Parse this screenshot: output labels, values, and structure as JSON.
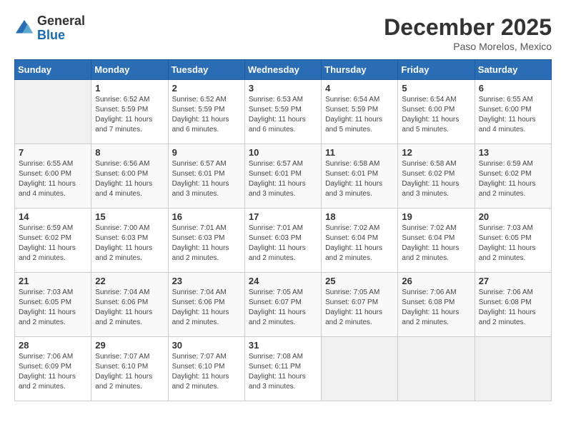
{
  "logo": {
    "general": "General",
    "blue": "Blue"
  },
  "title": "December 2025",
  "location": "Paso Morelos, Mexico",
  "days_header": [
    "Sunday",
    "Monday",
    "Tuesday",
    "Wednesday",
    "Thursday",
    "Friday",
    "Saturday"
  ],
  "weeks": [
    [
      {
        "day": "",
        "info": ""
      },
      {
        "day": "1",
        "info": "Sunrise: 6:52 AM\nSunset: 5:59 PM\nDaylight: 11 hours\nand 7 minutes."
      },
      {
        "day": "2",
        "info": "Sunrise: 6:52 AM\nSunset: 5:59 PM\nDaylight: 11 hours\nand 6 minutes."
      },
      {
        "day": "3",
        "info": "Sunrise: 6:53 AM\nSunset: 5:59 PM\nDaylight: 11 hours\nand 6 minutes."
      },
      {
        "day": "4",
        "info": "Sunrise: 6:54 AM\nSunset: 5:59 PM\nDaylight: 11 hours\nand 5 minutes."
      },
      {
        "day": "5",
        "info": "Sunrise: 6:54 AM\nSunset: 6:00 PM\nDaylight: 11 hours\nand 5 minutes."
      },
      {
        "day": "6",
        "info": "Sunrise: 6:55 AM\nSunset: 6:00 PM\nDaylight: 11 hours\nand 4 minutes."
      }
    ],
    [
      {
        "day": "7",
        "info": "Sunrise: 6:55 AM\nSunset: 6:00 PM\nDaylight: 11 hours\nand 4 minutes."
      },
      {
        "day": "8",
        "info": "Sunrise: 6:56 AM\nSunset: 6:00 PM\nDaylight: 11 hours\nand 4 minutes."
      },
      {
        "day": "9",
        "info": "Sunrise: 6:57 AM\nSunset: 6:01 PM\nDaylight: 11 hours\nand 3 minutes."
      },
      {
        "day": "10",
        "info": "Sunrise: 6:57 AM\nSunset: 6:01 PM\nDaylight: 11 hours\nand 3 minutes."
      },
      {
        "day": "11",
        "info": "Sunrise: 6:58 AM\nSunset: 6:01 PM\nDaylight: 11 hours\nand 3 minutes."
      },
      {
        "day": "12",
        "info": "Sunrise: 6:58 AM\nSunset: 6:02 PM\nDaylight: 11 hours\nand 3 minutes."
      },
      {
        "day": "13",
        "info": "Sunrise: 6:59 AM\nSunset: 6:02 PM\nDaylight: 11 hours\nand 2 minutes."
      }
    ],
    [
      {
        "day": "14",
        "info": "Sunrise: 6:59 AM\nSunset: 6:02 PM\nDaylight: 11 hours\nand 2 minutes."
      },
      {
        "day": "15",
        "info": "Sunrise: 7:00 AM\nSunset: 6:03 PM\nDaylight: 11 hours\nand 2 minutes."
      },
      {
        "day": "16",
        "info": "Sunrise: 7:01 AM\nSunset: 6:03 PM\nDaylight: 11 hours\nand 2 minutes."
      },
      {
        "day": "17",
        "info": "Sunrise: 7:01 AM\nSunset: 6:03 PM\nDaylight: 11 hours\nand 2 minutes."
      },
      {
        "day": "18",
        "info": "Sunrise: 7:02 AM\nSunset: 6:04 PM\nDaylight: 11 hours\nand 2 minutes."
      },
      {
        "day": "19",
        "info": "Sunrise: 7:02 AM\nSunset: 6:04 PM\nDaylight: 11 hours\nand 2 minutes."
      },
      {
        "day": "20",
        "info": "Sunrise: 7:03 AM\nSunset: 6:05 PM\nDaylight: 11 hours\nand 2 minutes."
      }
    ],
    [
      {
        "day": "21",
        "info": "Sunrise: 7:03 AM\nSunset: 6:05 PM\nDaylight: 11 hours\nand 2 minutes."
      },
      {
        "day": "22",
        "info": "Sunrise: 7:04 AM\nSunset: 6:06 PM\nDaylight: 11 hours\nand 2 minutes."
      },
      {
        "day": "23",
        "info": "Sunrise: 7:04 AM\nSunset: 6:06 PM\nDaylight: 11 hours\nand 2 minutes."
      },
      {
        "day": "24",
        "info": "Sunrise: 7:05 AM\nSunset: 6:07 PM\nDaylight: 11 hours\nand 2 minutes."
      },
      {
        "day": "25",
        "info": "Sunrise: 7:05 AM\nSunset: 6:07 PM\nDaylight: 11 hours\nand 2 minutes."
      },
      {
        "day": "26",
        "info": "Sunrise: 7:06 AM\nSunset: 6:08 PM\nDaylight: 11 hours\nand 2 minutes."
      },
      {
        "day": "27",
        "info": "Sunrise: 7:06 AM\nSunset: 6:08 PM\nDaylight: 11 hours\nand 2 minutes."
      }
    ],
    [
      {
        "day": "28",
        "info": "Sunrise: 7:06 AM\nSunset: 6:09 PM\nDaylight: 11 hours\nand 2 minutes."
      },
      {
        "day": "29",
        "info": "Sunrise: 7:07 AM\nSunset: 6:10 PM\nDaylight: 11 hours\nand 2 minutes."
      },
      {
        "day": "30",
        "info": "Sunrise: 7:07 AM\nSunset: 6:10 PM\nDaylight: 11 hours\nand 2 minutes."
      },
      {
        "day": "31",
        "info": "Sunrise: 7:08 AM\nSunset: 6:11 PM\nDaylight: 11 hours\nand 3 minutes."
      },
      {
        "day": "",
        "info": ""
      },
      {
        "day": "",
        "info": ""
      },
      {
        "day": "",
        "info": ""
      }
    ]
  ]
}
